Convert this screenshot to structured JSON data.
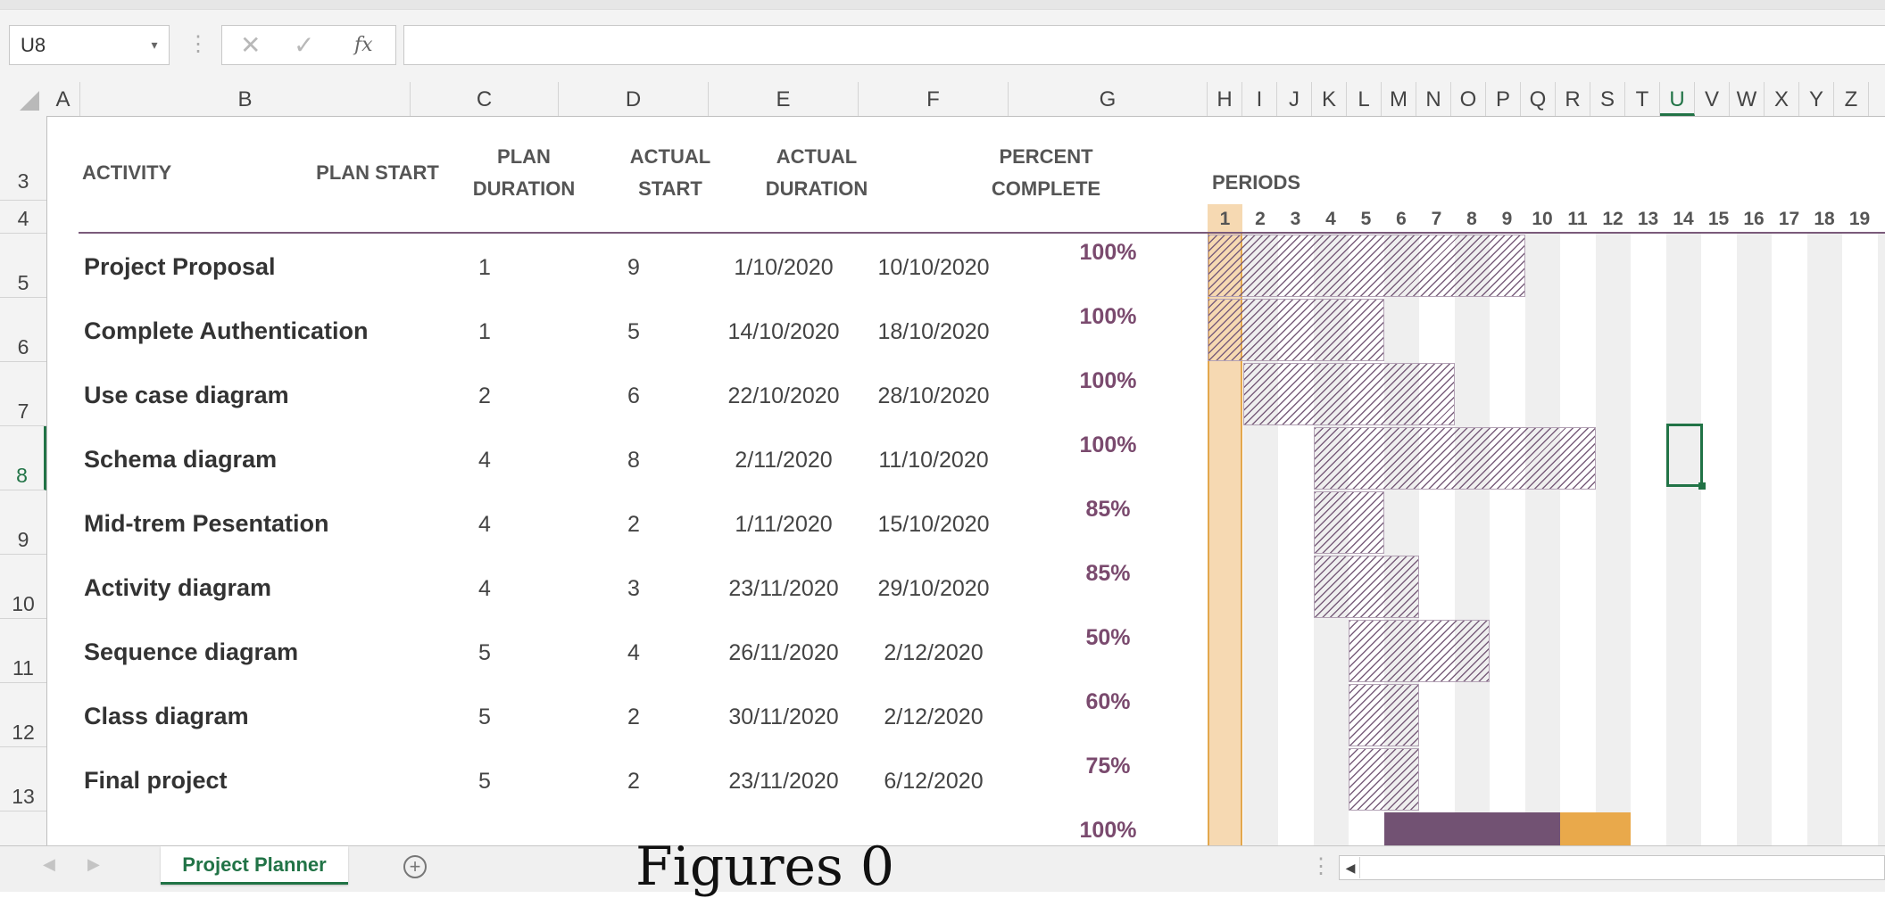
{
  "formula_bar": {
    "name_box": "U8",
    "name_box_arrow": "▾",
    "separator": "⋮",
    "cancel": "✕",
    "enter": "✓",
    "fx": "fx",
    "formula": ""
  },
  "columns": [
    "A",
    "B",
    "C",
    "D",
    "E",
    "F",
    "G",
    "H",
    "I",
    "J",
    "K",
    "L",
    "M",
    "N",
    "O",
    "P",
    "Q",
    "R",
    "S",
    "T",
    "U",
    "V",
    "W",
    "X",
    "Y",
    "Z"
  ],
  "selected_column": "U",
  "rows": [
    "3",
    "4",
    "5",
    "6",
    "7",
    "8",
    "9",
    "10",
    "11",
    "12",
    "13"
  ],
  "selected_row": "8",
  "headers": {
    "activity": "ACTIVITY",
    "plan_start": "PLAN START",
    "plan_duration_1": "PLAN",
    "plan_duration_2": "DURATION",
    "actual_start_1": "ACTUAL",
    "actual_start_2": "START",
    "actual_duration_1": "ACTUAL",
    "actual_duration_2": "DURATION",
    "percent_1": "PERCENT",
    "percent_2": "COMPLETE",
    "periods": "PERIODS"
  },
  "period_numbers": [
    "1",
    "2",
    "3",
    "4",
    "5",
    "6",
    "7",
    "8",
    "9",
    "10",
    "11",
    "12",
    "13",
    "14",
    "15",
    "16",
    "17",
    "18",
    "19"
  ],
  "current_period": "1",
  "tasks": [
    {
      "activity": "Project Proposal",
      "plan_start": "1",
      "plan_duration": "9",
      "actual_start": "1/10/2020",
      "actual_duration": "10/10/2020",
      "percent": "100%",
      "bar_start": 1,
      "bar_periods": 9
    },
    {
      "activity": "Complete Authentication",
      "plan_start": "1",
      "plan_duration": "5",
      "actual_start": "14/10/2020",
      "actual_duration": "18/10/2020",
      "percent": "100%",
      "bar_start": 1,
      "bar_periods": 5
    },
    {
      "activity": "Use case diagram",
      "plan_start": "2",
      "plan_duration": "6",
      "actual_start": "22/10/2020",
      "actual_duration": "28/10/2020",
      "percent": "100%",
      "bar_start": 2,
      "bar_periods": 6
    },
    {
      "activity": "Schema diagram",
      "plan_start": "4",
      "plan_duration": "8",
      "actual_start": "2/11/2020",
      "actual_duration": "11/10/2020",
      "percent": "100%",
      "bar_start": 4,
      "bar_periods": 8
    },
    {
      "activity": "Mid-trem Pesentation",
      "plan_start": "4",
      "plan_duration": "2",
      "actual_start": "1/11/2020",
      "actual_duration": "15/10/2020",
      "percent": "85%",
      "bar_start": 4,
      "bar_periods": 2
    },
    {
      "activity": "Activity diagram",
      "plan_start": "4",
      "plan_duration": "3",
      "actual_start": "23/11/2020",
      "actual_duration": "29/10/2020",
      "percent": "85%",
      "bar_start": 4,
      "bar_periods": 3
    },
    {
      "activity": "Sequence diagram",
      "plan_start": "5",
      "plan_duration": "4",
      "actual_start": "26/11/2020",
      "actual_duration": "2/12/2020",
      "percent": "50%",
      "bar_start": 5,
      "bar_periods": 4
    },
    {
      "activity": "Class diagram",
      "plan_start": "5",
      "plan_duration": "2",
      "actual_start": "30/11/2020",
      "actual_duration": "2/12/2020",
      "percent": "60%",
      "bar_start": 5,
      "bar_periods": 2
    },
    {
      "activity": "Final project",
      "plan_start": "5",
      "plan_duration": "2",
      "actual_start": "23/11/2020",
      "actual_duration": "6/12/2020",
      "percent": "75%",
      "bar_start": 5,
      "bar_periods": 2
    }
  ],
  "partial_row": {
    "percent": "100%",
    "complete_from": 6,
    "complete_periods": 5,
    "remaining_periods": 2
  },
  "colors": {
    "accent_green": "#217346",
    "bar_purple": "#7a5f7c",
    "complete_purple": "#725273",
    "beyond_orange": "#e9a94b",
    "current_period_fill": "#f6d9b2"
  },
  "tab_bar": {
    "sheet_tab": "Project Planner",
    "add_sheet": "+",
    "prev": "◀",
    "next": "▶",
    "scroll_left": "◀",
    "caption": "Figures 0"
  }
}
